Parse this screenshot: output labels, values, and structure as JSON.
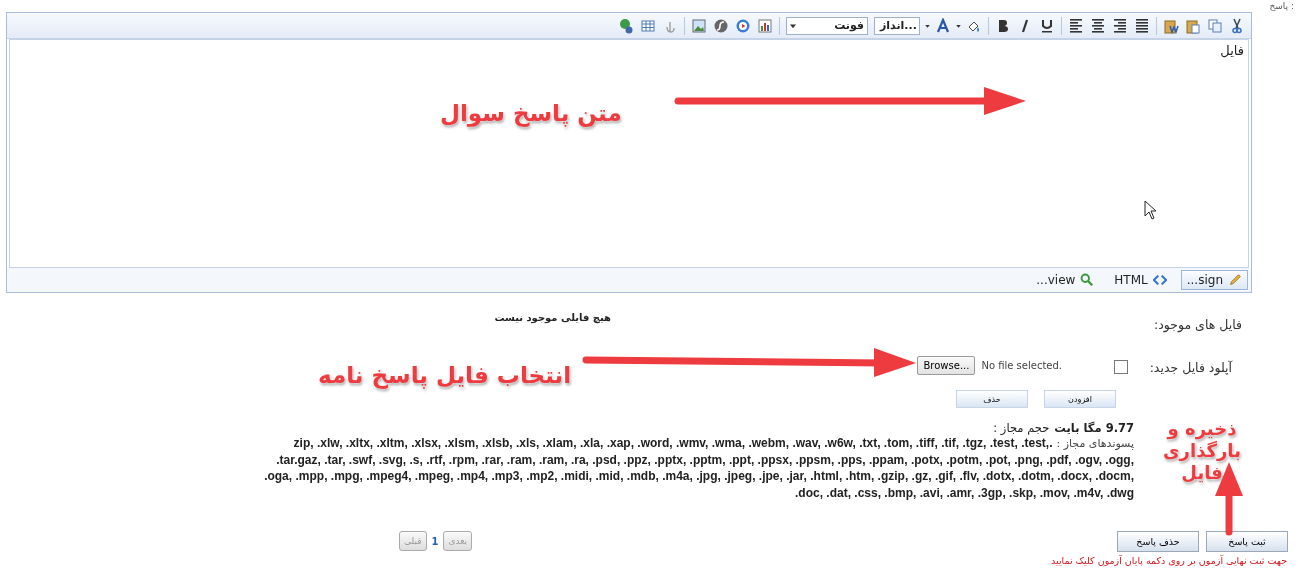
{
  "answer_label": "پاسخ :",
  "editor": {
    "size_select": "انداز...",
    "font_select": "فونت",
    "content": "فایل",
    "modes": [
      {
        "label": "...sign",
        "selected": true,
        "kind": "design"
      },
      {
        "label": "HTML",
        "selected": false,
        "kind": "html"
      },
      {
        "label": "...view",
        "selected": false,
        "kind": "preview"
      }
    ]
  },
  "existing_files": {
    "label": "فایل های موجود:",
    "value": "هیچ فایلی موجود نیست"
  },
  "upload": {
    "label": "آپلود فایل جدید:",
    "checked": false,
    "browse_button": "Browse...",
    "file_status": "No file selected."
  },
  "file_buttons": [
    "افزودن",
    "حذف"
  ],
  "max_size": {
    "label": "حجم مجاز :",
    "value": "9.77 مگا بایت"
  },
  "extensions": {
    "label": "پسوندهای مجاز :",
    "lines": [
      "zip, .xlw, .xltx, .xltm, .xlsx, .xlsm, .xlsb, .xls, .xlam, .xla, .xap, .word, .wmv, .wma, .webm, .wav, .w6w, .txt, .tom, .tiff, .tif, .tgz, .test, .test,.",
      ".tar.gaz, .tar, .swf, .svg, .s, .rtf, .rpm, .rar, .ram, .ram, .ra, .psd, .ppz, .pptx, .pptm, .ppt, .ppsx, .ppsm, .pps, .ppam, .potx, .potm, .pot, .png, .pdf, .ogv, .ogg,",
      ".oga, .mpp, .mpg, .mpeg4, .mpeg, .mp4, .mp3, .mp2, .midi, .mid, .mdb, .m4a, .jpg, .jpeg, .jpe, .jar, .html, .htm, .gzip, .gz, .gif, .flv, .dotx, .dotm, .docx, .docm,",
      ".doc, .dat, .css, .bmp, .avi, .amr, .3gp, .skp, .mov, .m4v, .dwg"
    ]
  },
  "pager": {
    "prev": {
      "label": "قبلی",
      "disabled": true
    },
    "page": "1",
    "next": {
      "label": "بعدی",
      "disabled": true
    }
  },
  "actions": [
    "ثبت پاسخ",
    "حذف پاسخ"
  ],
  "notice": "جهت ثبت نهایی آزمون بر روی دکمه پایان آزمون کلیک نمایید",
  "annotations": [
    {
      "kind": "editor",
      "text": "متن پاسخ سوال"
    },
    {
      "kind": "file",
      "text": "انتخاب فایل پاسخ نامه"
    },
    {
      "kind": "save",
      "text": "ذخیره و بارگذاری فایل"
    }
  ]
}
